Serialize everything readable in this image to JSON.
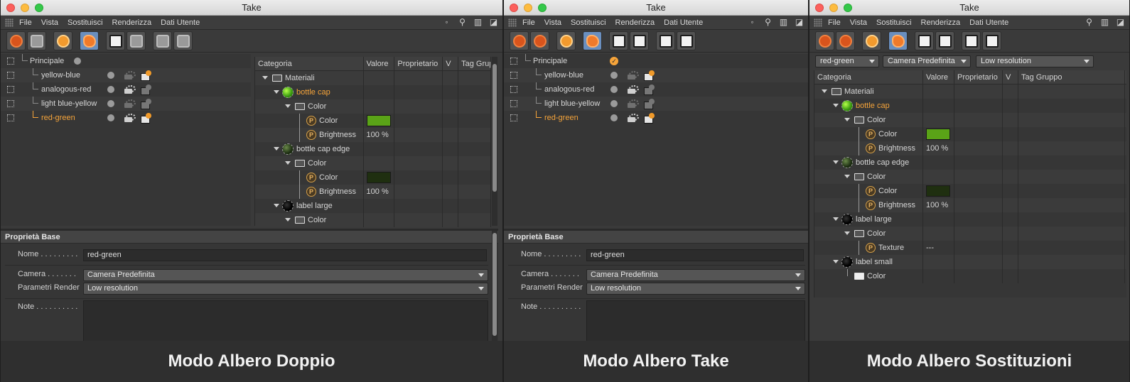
{
  "window_title": "Take",
  "menu": [
    "File",
    "Vista",
    "Sostituisci",
    "Renderizza",
    "Dati Utente"
  ],
  "captions": {
    "dual": "Modo Albero Doppio",
    "take": "Modo Albero Take",
    "override": "Modo Albero Sostituzioni"
  },
  "takes": {
    "root": "Principale",
    "items": [
      "yellow-blue",
      "analogous-red",
      "light blue-yellow",
      "red-green"
    ],
    "selected": "red-green"
  },
  "override_columns": [
    "Categoria",
    "Valore",
    "Proprietario",
    "V",
    "Tag Gruppo"
  ],
  "override_rows": {
    "materiali": "Materiali",
    "bottle_cap": "bottle cap",
    "color_group": "Color",
    "color_param": "Color",
    "brightness": "Brightness",
    "brightness_value": "100 %",
    "bottle_cap_edge": "bottle cap edge",
    "label_large": "label large",
    "texture": "Texture",
    "texture_value": "---",
    "label_small": "label small"
  },
  "colors": {
    "bottle_cap_color": "#5aa317",
    "bottle_cap_edge_color": "#1f2f10",
    "accent_orange": "#f6a43a"
  },
  "props": {
    "title": "Proprietà Base",
    "nome_label": "Nome . . . . . . . . .",
    "nome_value": "red-green",
    "camera_label": "Camera . . . . . . .",
    "camera_value": "Camera Predefinita",
    "render_label": "Parametri Render",
    "render_value": "Low resolution",
    "note_label": "Note . . . . . . . . . ."
  },
  "override_selectors": {
    "take": "red-green",
    "camera": "Camera Predefinita",
    "render": "Low resolution"
  }
}
